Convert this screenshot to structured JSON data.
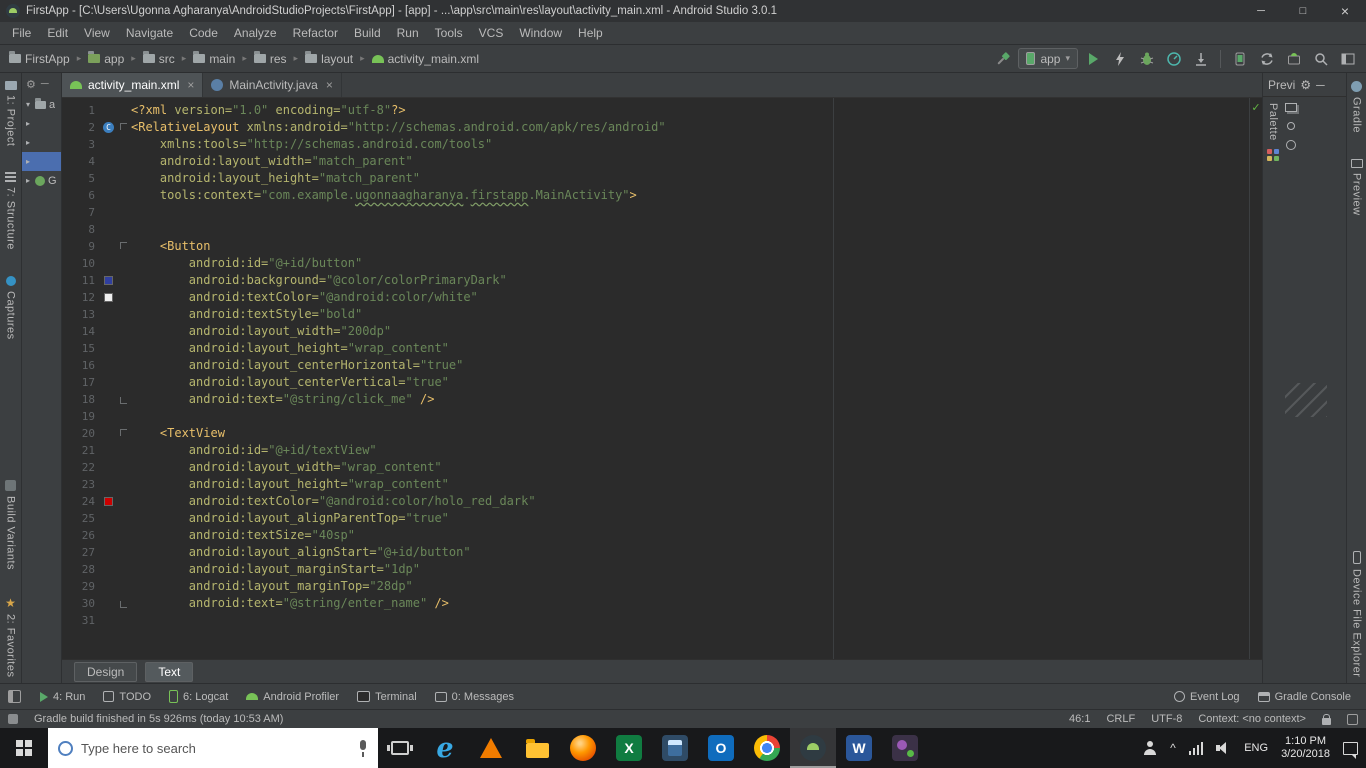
{
  "title_bar": {
    "title": "FirstApp - [C:\\Users\\Ugonna Agharanya\\AndroidStudioProjects\\FirstApp] - [app] - ...\\app\\src\\main\\res\\layout\\activity_main.xml - Android Studio 3.0.1"
  },
  "glyphs": {
    "minimize_window": "─",
    "maximize_window": "□",
    "close_window": "×",
    "crumb_sep": "▸",
    "caret_down": "▾",
    "close_tab": "×",
    "gear": "⚙",
    "minimize_panel": "─",
    "expand_open": "▾",
    "expand_closed": "▸",
    "star": "★",
    "chevron_up": "^"
  },
  "menu_bar": {
    "items": [
      "File",
      "Edit",
      "View",
      "Navigate",
      "Code",
      "Analyze",
      "Refactor",
      "Build",
      "Run",
      "Tools",
      "VCS",
      "Window",
      "Help"
    ]
  },
  "nav_bar": {
    "breadcrumbs": [
      {
        "label": "FirstApp",
        "icon": "project-folder-icon"
      },
      {
        "label": "app",
        "icon": "module-folder-icon"
      },
      {
        "label": "src",
        "icon": "folder-icon"
      },
      {
        "label": "main",
        "icon": "folder-icon"
      },
      {
        "label": "res",
        "icon": "folder-icon"
      },
      {
        "label": "layout",
        "icon": "folder-icon"
      },
      {
        "label": "activity_main.xml",
        "icon": "xml-file-icon"
      }
    ],
    "run_config": {
      "label": "app"
    }
  },
  "editor_tabs": [
    {
      "label": "activity_main.xml",
      "icon": "android-file-icon",
      "selected": true
    },
    {
      "label": "MainActivity.java",
      "icon": "class-icon",
      "selected": false
    }
  ],
  "left_tool_buttons_top": [
    {
      "label": "1: Project",
      "icon": "project-icon"
    },
    {
      "label": "7: Structure",
      "icon": "structure-icon"
    },
    {
      "label": "Captures",
      "icon": "captures-icon"
    }
  ],
  "left_tool_buttons_bottom": [
    {
      "label": "Build Variants",
      "icon": "build-variants-icon"
    },
    {
      "label": "2: Favorites",
      "icon": "favorites-icon"
    }
  ],
  "right_tool_buttons_top": [
    {
      "label": "Gradle",
      "icon": "gradle-icon"
    },
    {
      "label": "Preview",
      "icon": "preview-icon"
    }
  ],
  "right_tool_buttons_bottom": [
    {
      "label": "Device File Explorer",
      "icon": "device-explorer-icon"
    }
  ],
  "project_panel": {
    "rows": [
      {
        "expand": "open",
        "icon": "folder-icon",
        "label": "a"
      },
      {
        "expand": "closed"
      },
      {
        "expand": "closed"
      },
      {
        "expand": "closed",
        "selected": true
      },
      {
        "expand": "closed",
        "icon": "gradle-icon",
        "label": "G"
      }
    ]
  },
  "preview_panel": {
    "header": "Previ",
    "palette_label": "Palette"
  },
  "design_text_tabs": [
    {
      "label": "Design",
      "selected": false
    },
    {
      "label": "Text",
      "selected": true
    }
  ],
  "code": {
    "inspection_status": "✓",
    "lines": [
      {
        "n": 1,
        "s": [
          [
            "t",
            "<?xml "
          ],
          [
            "a",
            "version="
          ],
          [
            "v",
            "\"1.0\""
          ],
          [
            "a",
            " encoding="
          ],
          [
            "v",
            "\"utf-8\""
          ],
          [
            "t",
            "?>"
          ]
        ]
      },
      {
        "n": 2,
        "s": [
          [
            "t",
            "<RelativeLayout "
          ],
          [
            "a",
            "xmlns:android="
          ],
          [
            "v",
            "\"http://schemas.android.com/apk/res/android\""
          ]
        ]
      },
      {
        "n": 3,
        "s": [
          [
            "p",
            "    "
          ],
          [
            "a",
            "xmlns:tools="
          ],
          [
            "v",
            "\"http://schemas.android.com/tools\""
          ]
        ]
      },
      {
        "n": 4,
        "s": [
          [
            "p",
            "    "
          ],
          [
            "a",
            "android:layout_width="
          ],
          [
            "v",
            "\"match_parent\""
          ]
        ]
      },
      {
        "n": 5,
        "s": [
          [
            "p",
            "    "
          ],
          [
            "a",
            "android:layout_height="
          ],
          [
            "v",
            "\"match_parent\""
          ]
        ]
      },
      {
        "n": 6,
        "s": [
          [
            "p",
            "    "
          ],
          [
            "a",
            "tools:context="
          ],
          [
            "v",
            "\"com.example."
          ],
          [
            "w",
            "ugonnaagharanya"
          ],
          [
            "v",
            "."
          ],
          [
            "w",
            "firstapp"
          ],
          [
            "v",
            ".MainActivity\""
          ],
          [
            "t",
            ">"
          ]
        ]
      },
      {
        "n": 7,
        "s": []
      },
      {
        "n": 8,
        "s": []
      },
      {
        "n": 9,
        "s": [
          [
            "p",
            "    "
          ],
          [
            "t",
            "<Button"
          ]
        ]
      },
      {
        "n": 10,
        "s": [
          [
            "p",
            "        "
          ],
          [
            "a",
            "android:id="
          ],
          [
            "v",
            "\"@+id/button\""
          ]
        ]
      },
      {
        "n": 11,
        "s": [
          [
            "p",
            "        "
          ],
          [
            "a",
            "android:background="
          ],
          [
            "v",
            "\"@color/colorPrimaryDark\""
          ]
        ]
      },
      {
        "n": 12,
        "s": [
          [
            "p",
            "        "
          ],
          [
            "a",
            "android:textColor="
          ],
          [
            "v",
            "\"@android:color/white\""
          ]
        ]
      },
      {
        "n": 13,
        "s": [
          [
            "p",
            "        "
          ],
          [
            "a",
            "android:textStyle="
          ],
          [
            "v",
            "\"bold\""
          ]
        ]
      },
      {
        "n": 14,
        "s": [
          [
            "p",
            "        "
          ],
          [
            "a",
            "android:layout_width="
          ],
          [
            "v",
            "\"200dp\""
          ]
        ]
      },
      {
        "n": 15,
        "s": [
          [
            "p",
            "        "
          ],
          [
            "a",
            "android:layout_height="
          ],
          [
            "v",
            "\"wrap_content\""
          ]
        ]
      },
      {
        "n": 16,
        "s": [
          [
            "p",
            "        "
          ],
          [
            "a",
            "android:layout_centerHorizontal="
          ],
          [
            "v",
            "\"true\""
          ]
        ]
      },
      {
        "n": 17,
        "s": [
          [
            "p",
            "        "
          ],
          [
            "a",
            "android:layout_centerVertical="
          ],
          [
            "v",
            "\"true\""
          ]
        ]
      },
      {
        "n": 18,
        "s": [
          [
            "p",
            "        "
          ],
          [
            "a",
            "android:text="
          ],
          [
            "v",
            "\"@string/click_me\""
          ],
          [
            "t",
            " />"
          ]
        ]
      },
      {
        "n": 19,
        "s": []
      },
      {
        "n": 20,
        "s": [
          [
            "p",
            "    "
          ],
          [
            "t",
            "<TextView"
          ]
        ]
      },
      {
        "n": 21,
        "s": [
          [
            "p",
            "        "
          ],
          [
            "a",
            "android:id="
          ],
          [
            "v",
            "\"@+id/textView\""
          ]
        ]
      },
      {
        "n": 22,
        "s": [
          [
            "p",
            "        "
          ],
          [
            "a",
            "android:layout_width="
          ],
          [
            "v",
            "\"wrap_content\""
          ]
        ]
      },
      {
        "n": 23,
        "s": [
          [
            "p",
            "        "
          ],
          [
            "a",
            "android:layout_height="
          ],
          [
            "v",
            "\"wrap_content\""
          ]
        ]
      },
      {
        "n": 24,
        "s": [
          [
            "p",
            "        "
          ],
          [
            "a",
            "android:textColor="
          ],
          [
            "v",
            "\"@android:color/holo_red_dark\""
          ]
        ]
      },
      {
        "n": 25,
        "s": [
          [
            "p",
            "        "
          ],
          [
            "a",
            "android:layout_alignParentTop="
          ],
          [
            "v",
            "\"true\""
          ]
        ]
      },
      {
        "n": 26,
        "s": [
          [
            "p",
            "        "
          ],
          [
            "a",
            "android:textSize="
          ],
          [
            "v",
            "\"40sp\""
          ]
        ]
      },
      {
        "n": 27,
        "s": [
          [
            "p",
            "        "
          ],
          [
            "a",
            "android:layout_alignStart="
          ],
          [
            "v",
            "\"@+id/button\""
          ]
        ]
      },
      {
        "n": 28,
        "s": [
          [
            "p",
            "        "
          ],
          [
            "a",
            "android:layout_marginStart="
          ],
          [
            "v",
            "\"1dp\""
          ]
        ]
      },
      {
        "n": 29,
        "s": [
          [
            "p",
            "        "
          ],
          [
            "a",
            "android:layout_marginTop="
          ],
          [
            "v",
            "\"28dp\""
          ]
        ]
      },
      {
        "n": 30,
        "s": [
          [
            "p",
            "        "
          ],
          [
            "a",
            "android:text="
          ],
          [
            "v",
            "\"@string/enter_name\""
          ],
          [
            "t",
            " />"
          ]
        ]
      },
      {
        "n": 31,
        "s": []
      }
    ],
    "marks": {
      "2": {
        "type": "class",
        "label": "C"
      },
      "11": {
        "type": "swatch",
        "color": "#303F9F"
      },
      "12": {
        "type": "swatch",
        "color": "#EEEEEE"
      },
      "24": {
        "type": "swatch",
        "color": "#CC0000"
      }
    },
    "folds": {
      "2": "start",
      "9": "start",
      "18": "end",
      "20": "start",
      "30": "end"
    }
  },
  "bottom_tool_bar": {
    "left": [
      {
        "label": "4: Run",
        "icon": "run-icon"
      },
      {
        "label": "TODO",
        "icon": "todo-icon"
      },
      {
        "label": "6: Logcat",
        "icon": "logcat-icon"
      },
      {
        "label": "Android Profiler",
        "icon": "android-profiler-icon"
      },
      {
        "label": "Terminal",
        "icon": "terminal-icon"
      },
      {
        "label": "0: Messages",
        "icon": "messages-icon"
      }
    ],
    "right": [
      {
        "label": "Event Log",
        "icon": "event-log-icon"
      },
      {
        "label": "Gradle Console",
        "icon": "gradle-console-icon"
      }
    ]
  },
  "status_bar": {
    "message": "Gradle build finished in 5s 926ms (today 10:53 AM)",
    "caret": "46:1",
    "line_ending": "CRLF",
    "encoding": "UTF-8",
    "context": "Context: <no context>"
  },
  "taskbar": {
    "search_placeholder": "Type here to search",
    "apps": [
      {
        "name": "edge",
        "glyph": "e"
      },
      {
        "name": "vlc"
      },
      {
        "name": "file-explorer"
      },
      {
        "name": "firefox"
      },
      {
        "name": "excel",
        "glyph": "X"
      },
      {
        "name": "calculator"
      },
      {
        "name": "outlook",
        "glyph": "O"
      },
      {
        "name": "chrome"
      },
      {
        "name": "android-studio",
        "active": true
      },
      {
        "name": "word",
        "glyph": "W"
      },
      {
        "name": "dev-tool"
      }
    ],
    "tray": {
      "language": "ENG",
      "time": "1:10 PM",
      "date": "3/20/2018"
    }
  }
}
